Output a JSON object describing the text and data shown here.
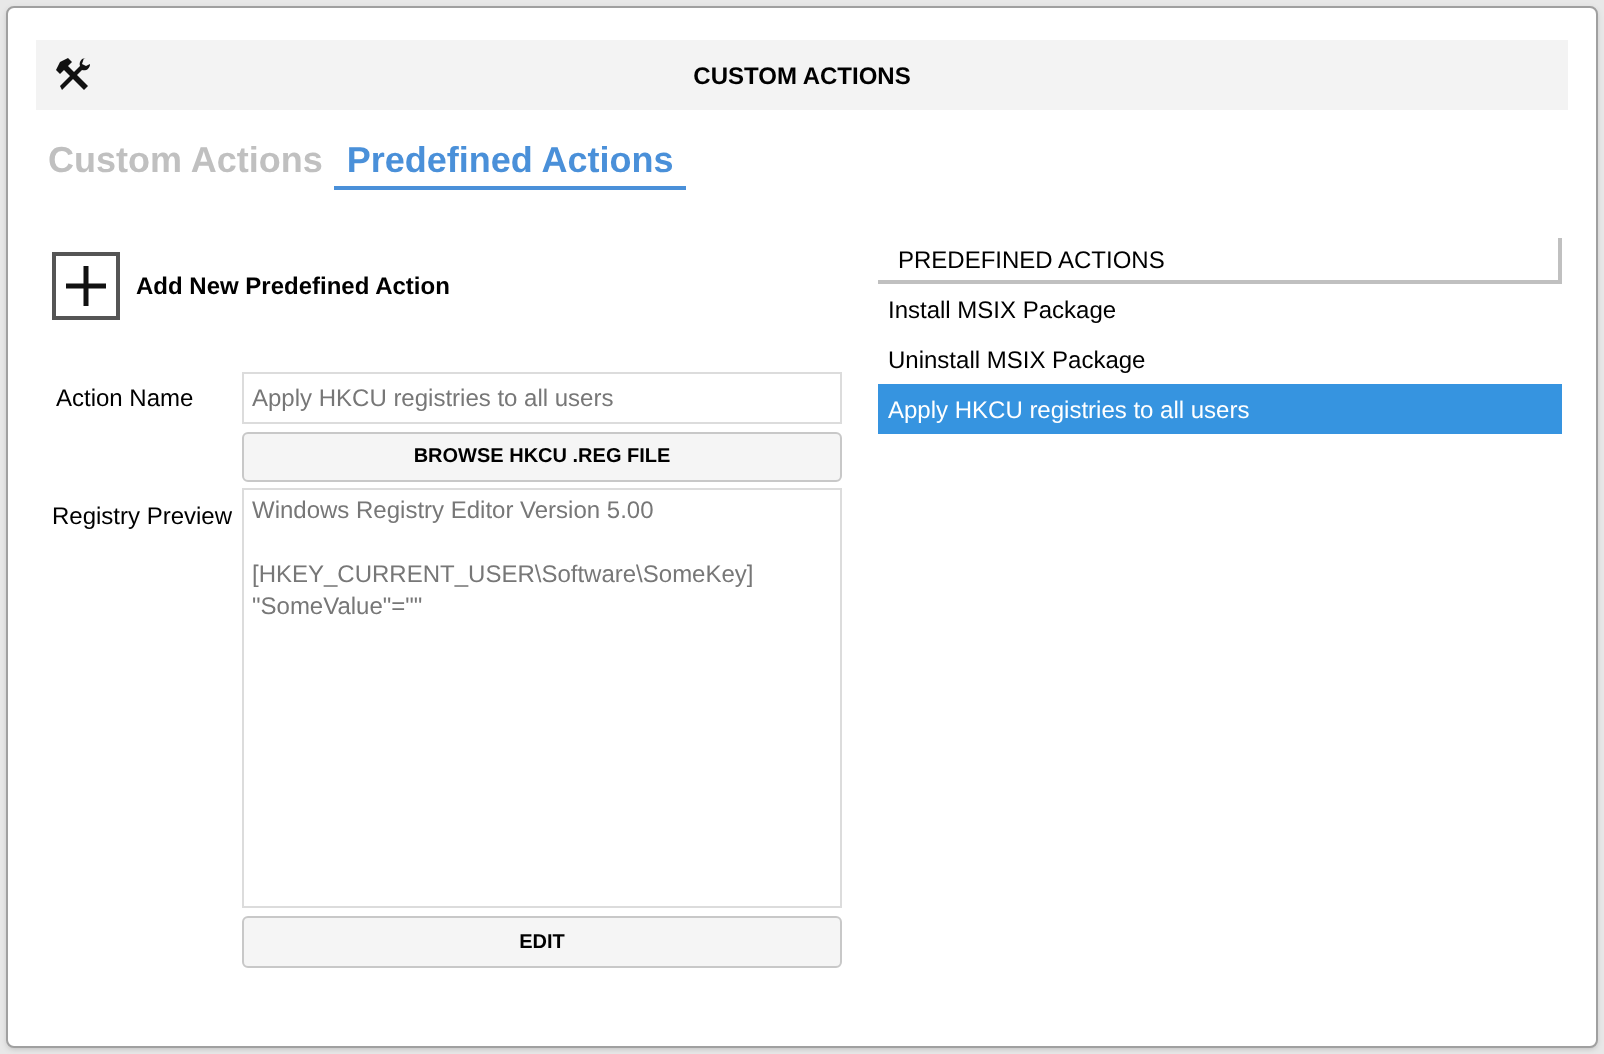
{
  "header": {
    "title": "CUSTOM ACTIONS"
  },
  "tabs": [
    {
      "label": "Custom Actions",
      "selected": false
    },
    {
      "label": "Predefined Actions",
      "selected": true
    }
  ],
  "add_action": {
    "label": "Add New Predefined Action"
  },
  "form": {
    "action_name": {
      "label": "Action Name",
      "value": "Apply HKCU registries to all users"
    },
    "browse_button": "BROWSE HKCU .REG FILE",
    "registry_preview": {
      "label": "Registry Preview",
      "value": "Windows Registry Editor Version 5.00\n\n[HKEY_CURRENT_USER\\Software\\SomeKey]\n\"SomeValue\"=\"\""
    },
    "edit_button": "EDIT"
  },
  "list": {
    "header": "PREDEFINED ACTIONS",
    "items": [
      {
        "label": "Install MSIX Package",
        "selected": false
      },
      {
        "label": "Uninstall MSIX Package",
        "selected": false
      },
      {
        "label": "Apply HKCU registries to all users",
        "selected": true
      }
    ]
  }
}
